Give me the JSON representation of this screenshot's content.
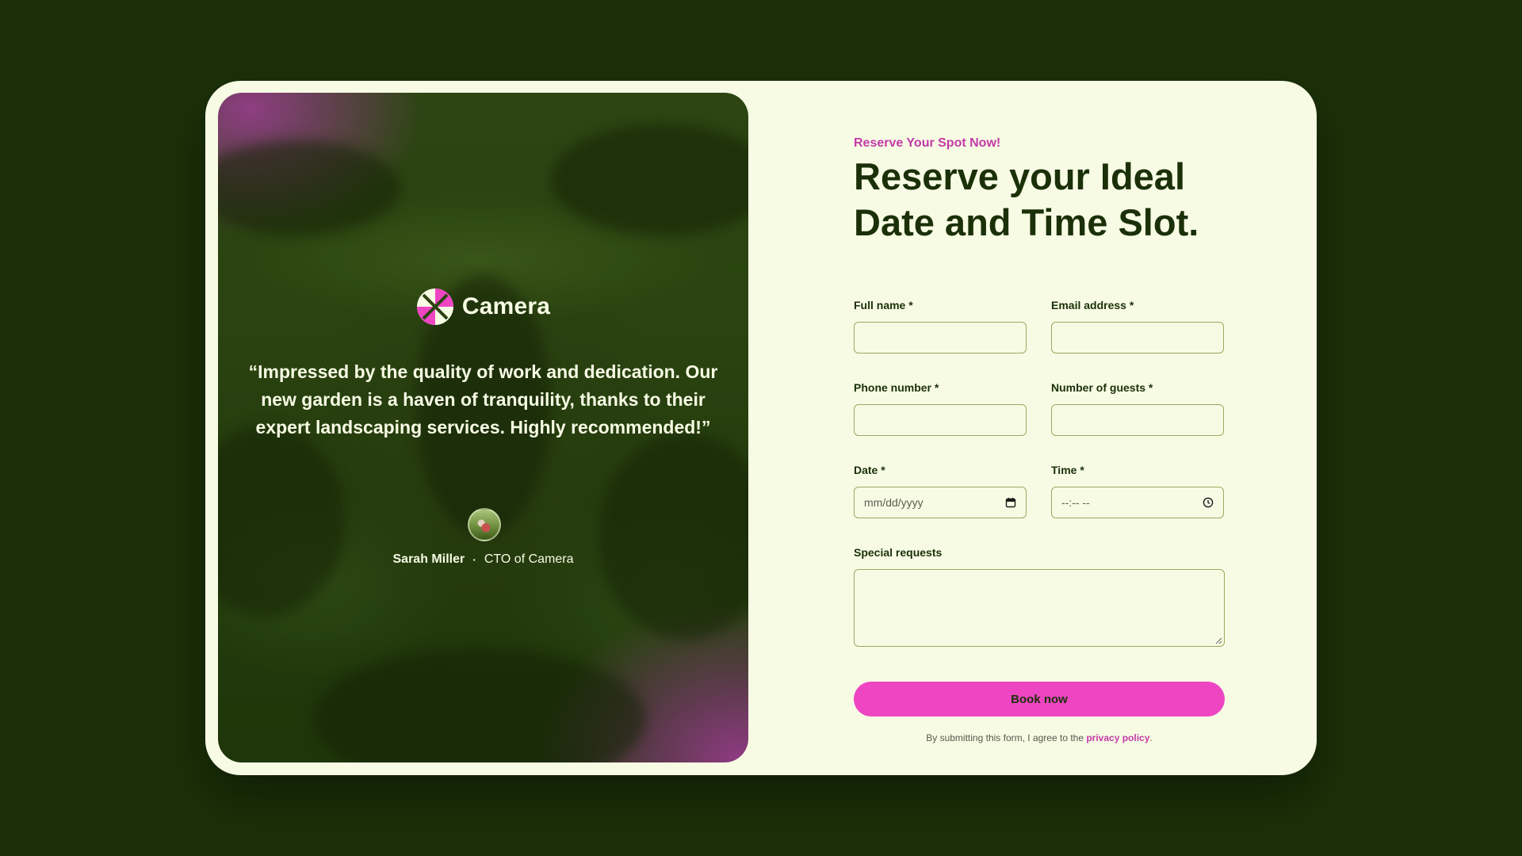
{
  "testimonial": {
    "brand_name": "Camera",
    "quote": "“Impressed by the quality of work and dedication. Our new garden is a haven of tranquility, thanks to their expert landscaping services. Highly recommended!”",
    "author_name": "Sarah Miller",
    "separator": "·",
    "author_role": "CTO of Camera"
  },
  "form": {
    "eyebrow": "Reserve Your Spot Now!",
    "headline": "Reserve your Ideal Date and Time Slot.",
    "full_name_label": "Full name *",
    "email_label": "Email address *",
    "phone_label": "Phone number *",
    "guests_label": "Number of guests *",
    "date_label": "Date *",
    "date_placeholder": "mm/dd/yyyy",
    "time_label": "Time *",
    "time_placeholder": "--:-- --",
    "special_requests_label": "Special requests",
    "submit_label": "Book now",
    "privacy_prefix": "By submitting this form, I agree to the ",
    "privacy_link": "privacy policy",
    "privacy_suffix": "."
  },
  "colors": {
    "background": "#1b3008",
    "card": "#f7fbe4",
    "accent_pink": "#ee45c3",
    "eyebrow_pink": "#c43aa8",
    "heading": "#1b3008",
    "field_border": "#9aaa5e"
  },
  "icons": {
    "brand_logo": "camera-logo-icon",
    "date_picker": "calendar-icon",
    "time_picker": "clock-icon",
    "textarea_resize": "resize-handle-icon"
  }
}
